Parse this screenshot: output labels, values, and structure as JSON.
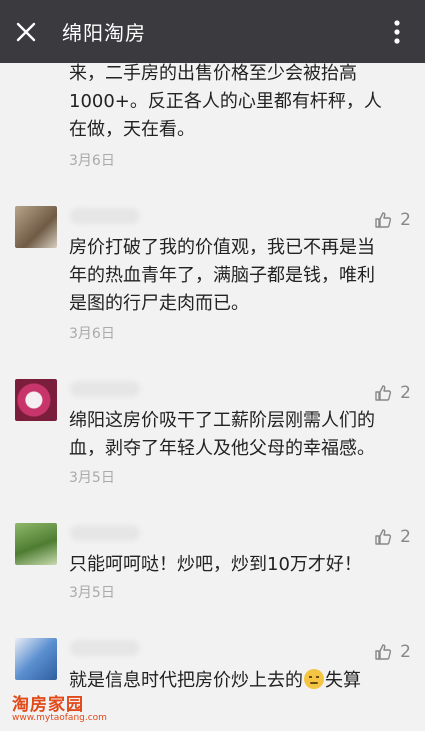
{
  "header": {
    "title": "绵阳淘房",
    "close_icon": "close-icon",
    "more_icon": "more-vertical-icon"
  },
  "colors": {
    "header_bg": "#3a3a3f",
    "text": "#222222",
    "meta": "#aaaaaa",
    "brand": "#e24a1a"
  },
  "comments": [
    {
      "text_lines": [
        "来，二手房的出售价格至少会被抬高",
        "1000+。反正各人的心里都有杆秤，人",
        "在做，天在看。"
      ],
      "date": "3月6日"
    },
    {
      "likes": "2",
      "text_lines": [
        "房价打破了我的价值观，我已不再是当",
        "年的热血青年了，满脑子都是钱，唯利",
        "是图的行尸走肉而已。"
      ],
      "date": "3月6日"
    },
    {
      "likes": "2",
      "text_lines": [
        "绵阳这房价吸干了工薪阶层刚需人们的",
        "血，剥夺了年轻人及他父母的幸福感。"
      ],
      "date": "3月5日"
    },
    {
      "likes": "2",
      "text_lines": [
        "只能呵呵哒！炒吧，炒到10万才好！"
      ],
      "date": "3月5日"
    },
    {
      "likes": "2",
      "text_before_emoji": "就是信息时代把房价炒上去的",
      "text_after_emoji": "失算"
    }
  ],
  "watermark": {
    "brand": "淘房家园",
    "url": "www.mytaofang.com"
  }
}
